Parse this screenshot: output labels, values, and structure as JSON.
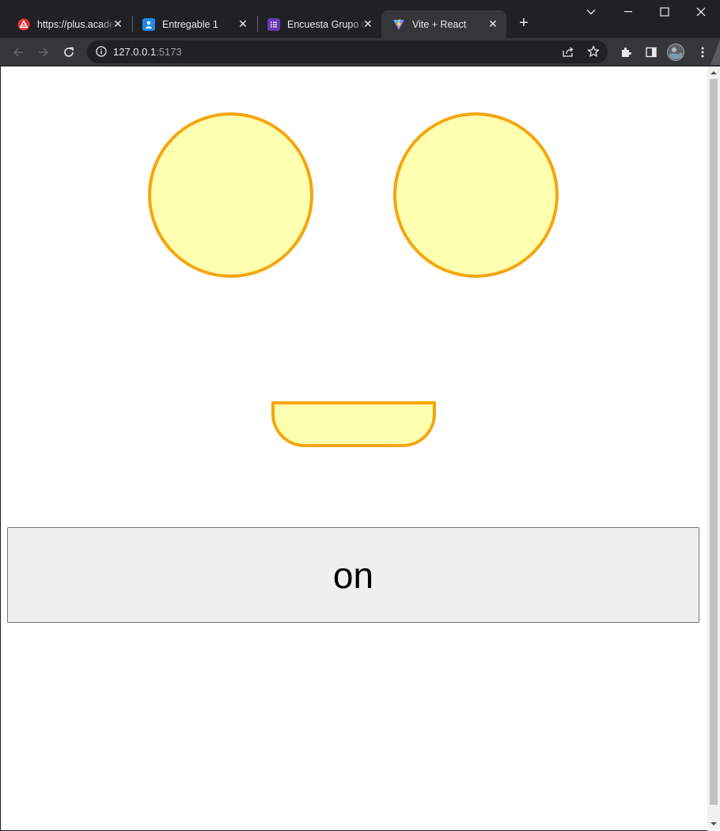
{
  "browser": {
    "tabs": [
      {
        "title": "https://plus.academy",
        "favicon": "academy-logo-icon",
        "favicon_color": "#e5313b",
        "active": false
      },
      {
        "title": "Entregable 1",
        "favicon": "classroom-icon",
        "favicon_color": "#1e88e5",
        "active": false
      },
      {
        "title": "Encuesta Grupo de",
        "favicon": "forms-icon",
        "favicon_color": "#673ab7",
        "active": false
      },
      {
        "title": "Vite + React",
        "favicon": "vite-logo-icon",
        "favicon_color": "#bd34fe",
        "active": true
      }
    ],
    "new_tab_label": "+",
    "address": {
      "host": "127.0.0.1",
      "port": ":5173"
    }
  },
  "page": {
    "toggle_button_label": "on"
  },
  "colors": {
    "face_fill": "#ffffb0",
    "face_stroke": "#f5a60d",
    "button_bg": "#efefef"
  }
}
